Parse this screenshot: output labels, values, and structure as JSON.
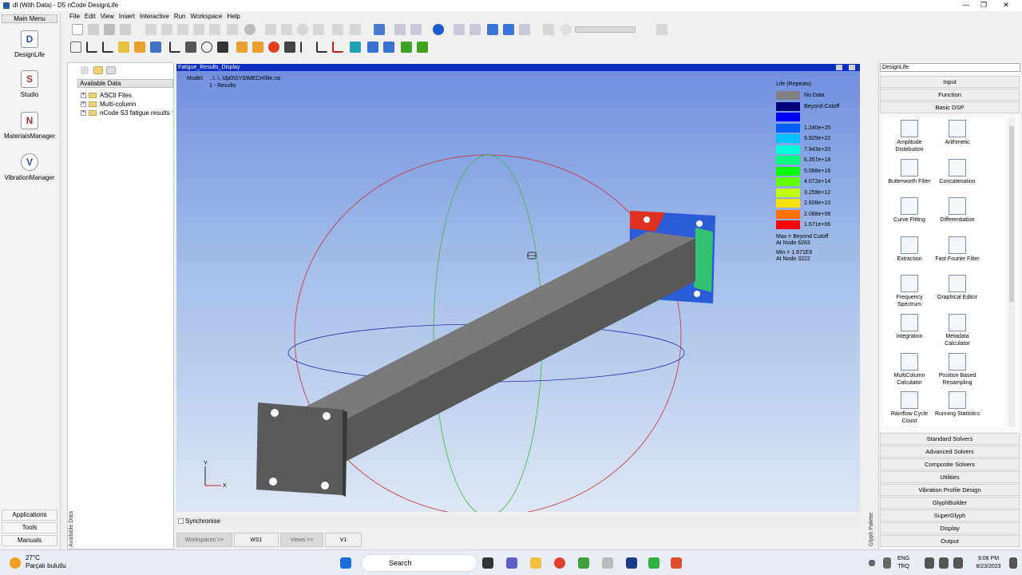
{
  "window": {
    "title": "dl (With Data) - D5 nCode DesignLife",
    "controls": [
      "—",
      "❐",
      "✕"
    ]
  },
  "menu": [
    "File",
    "Edit",
    "View",
    "Insert",
    "Interactive",
    "Run",
    "Workspace",
    "Help"
  ],
  "left_rail": {
    "main_menu": "Main Menu",
    "launchers": [
      {
        "label": "DesignLife",
        "icon": "D"
      },
      {
        "label": "Studio",
        "icon": "S"
      },
      {
        "label": "MaterialsManager",
        "icon": "N"
      },
      {
        "label": "VibrationManager",
        "icon": "V"
      }
    ],
    "bottom_buttons": [
      "Applications",
      "Tools",
      "Manuals"
    ]
  },
  "data_panel": {
    "header": "Available Data",
    "items": [
      "ASCII Files",
      "Multi-column",
      "nCode S3 fatigue results"
    ],
    "side_label": "Available Data"
  },
  "viewport": {
    "title": "Fatigue_Results_Display",
    "model_label": "Model:",
    "model_path": "..\\..\\..\\dp0\\SYS\\MECH\\file.rst",
    "result_line": "1 - Results",
    "axis_y": "Y",
    "axis_x": "X"
  },
  "legend": {
    "title": "Life (Repeats)",
    "entries": [
      {
        "label": "No Data",
        "color": "#808080"
      },
      {
        "label": "Beyond Cutoff",
        "color": "#00007a"
      },
      {
        "label": "",
        "color": "#0000ff"
      },
      {
        "label": "1.240e+25",
        "color": "#0060ff"
      },
      {
        "label": "9.925e+22",
        "color": "#00c0ff"
      },
      {
        "label": "7.943e+20",
        "color": "#00ffd8"
      },
      {
        "label": "6.357e+18",
        "color": "#00ff80"
      },
      {
        "label": "5.088e+16",
        "color": "#00ff00"
      },
      {
        "label": "4.072e+14",
        "color": "#60ff00"
      },
      {
        "label": "3.259e+12",
        "color": "#c0ff00"
      },
      {
        "label": "2.608e+10",
        "color": "#ffe000"
      },
      {
        "label": "2.088e+08",
        "color": "#ff7000"
      },
      {
        "label": "1.671e+06",
        "color": "#ff0000"
      }
    ],
    "max_text": "Max = Beyond Cutoff",
    "max_node": "At Node 6283",
    "min_text": "Min = 1.671E6",
    "min_node": "At Node 3222"
  },
  "sync_label": "Synchronise",
  "bottom_tabs": [
    "Workspaces >>",
    "WS1",
    "Views >>",
    "V1"
  ],
  "right_panel": {
    "dropdown": "DesignLife",
    "top_categories": [
      "Input",
      "Function",
      "Basic DSP"
    ],
    "glyphs": [
      "Amplitude Distribution",
      "Arithmetic",
      "Butterworth Filter",
      "Concatenation",
      "Curve Fitting",
      "Differentiation",
      "Extraction",
      "Fast Fourier Filter",
      "Frequency Spectrum",
      "Graphical Editor",
      "Integration",
      "Metadata Calculator",
      "MultiColumn Calculator",
      "Position Based Resampling",
      "Rainflow Cycle Count",
      "Running Statistics"
    ],
    "bottom_categories": [
      "Standard Solvers",
      "Advanced Solvers",
      "Composite Solvers",
      "Utilities",
      "Vibration Profile Design",
      "GlyphBuilder",
      "SuperGlyph",
      "Display",
      "Output"
    ],
    "side_label": "Glyph Palette"
  },
  "taskbar": {
    "temp": "27°C",
    "weather": "Parçalı bulutlu",
    "search": "Search",
    "lang1": "ENG",
    "lang2": "TRQ",
    "time": "9:08 PM",
    "date": "8/23/2023"
  }
}
